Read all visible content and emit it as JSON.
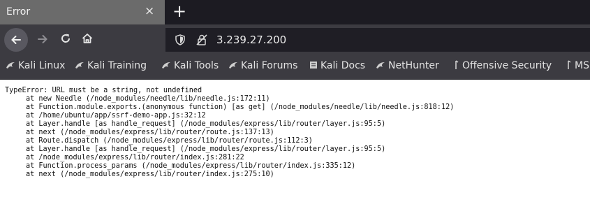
{
  "tab": {
    "title": "Error",
    "close": "×",
    "new_tab": "+"
  },
  "urlbar": {
    "url": "3.239.27.200"
  },
  "bookmarks": [
    {
      "label": "Kali Linux",
      "icon": "kali-dragon-icon"
    },
    {
      "label": "Kali Training",
      "icon": "kali-dragon-icon"
    },
    {
      "label": "Kali Tools",
      "icon": "kali-dragon-icon"
    },
    {
      "label": "Kali Forums",
      "icon": "kali-dragon-icon"
    },
    {
      "label": "Kali Docs",
      "icon": "kali-docs-icon"
    },
    {
      "label": "NetHunter",
      "icon": "kali-dragon-icon"
    },
    {
      "label": "Offensive Security",
      "icon": "offsec-icon"
    },
    {
      "label": "MS",
      "icon": "offsec-icon"
    }
  ],
  "error": {
    "message": "TypeError: URL must be a string, not undefined",
    "stack": [
      "at new Needle (/node_modules/needle/lib/needle.js:172:11)",
      "at Function.module.exports.(anonymous function) [as get] (/node_modules/needle/lib/needle.js:818:12)",
      "at /home/ubuntu/app/ssrf-demo-app.js:32:12",
      "at Layer.handle [as handle_request] (/node_modules/express/lib/router/layer.js:95:5)",
      "at next (/node_modules/express/lib/router/route.js:137:13)",
      "at Route.dispatch (/node_modules/express/lib/router/route.js:112:3)",
      "at Layer.handle [as handle_request] (/node_modules/express/lib/router/layer.js:95:5)",
      "at /node_modules/express/lib/router/index.js:281:22",
      "at Function.process_params (/node_modules/express/lib/router/index.js:335:12)",
      "at next (/node_modules/express/lib/router/index.js:275:10)"
    ]
  }
}
